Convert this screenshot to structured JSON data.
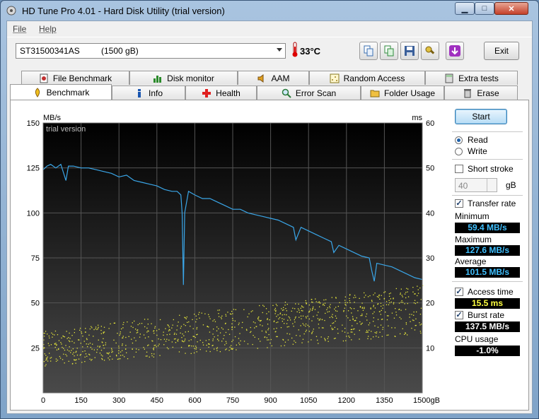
{
  "window": {
    "title": "HD Tune Pro 4.01 - Hard Disk Utility (trial version)"
  },
  "menu": {
    "items": [
      "File",
      "Help"
    ]
  },
  "toolbar": {
    "drive_name": "ST31500341AS",
    "drive_size": "(1500 gB)",
    "temperature": "33°C",
    "exit_label": "Exit"
  },
  "tabs": {
    "row1": [
      "File Benchmark",
      "Disk monitor",
      "AAM",
      "Random Access",
      "Extra tests"
    ],
    "row2": [
      "Benchmark",
      "Info",
      "Health",
      "Error Scan",
      "Folder Usage",
      "Erase"
    ],
    "active": "Benchmark"
  },
  "side": {
    "start_label": "Start",
    "read_label": "Read",
    "write_label": "Write",
    "mode_selected": "Read",
    "short_stroke_label": "Short stroke",
    "short_stroke_checked": false,
    "short_stroke_value": "40",
    "short_stroke_unit": "gB",
    "transfer_rate_label": "Transfer rate",
    "transfer_rate_checked": true,
    "minimum_label": "Minimum",
    "minimum_value": "59.4 MB/s",
    "maximum_label": "Maximum",
    "maximum_value": "127.6 MB/s",
    "average_label": "Average",
    "average_value": "101.5 MB/s",
    "access_time_label": "Access time",
    "access_time_checked": true,
    "access_time_value": "15.5 ms",
    "burst_rate_label": "Burst rate",
    "burst_rate_checked": true,
    "burst_rate_value": "137.5 MB/s",
    "cpu_usage_label": "CPU usage",
    "cpu_usage_value": "-1.0%"
  },
  "chart_data": {
    "type": "line",
    "watermark": "trial version",
    "y_left_unit": "MB/s",
    "y_right_unit": "ms",
    "x_unit": "gB",
    "xlim": [
      0,
      1500
    ],
    "ylim_left": [
      0,
      150
    ],
    "ylim_right": [
      0,
      60
    ],
    "x_ticks": [
      0,
      150,
      300,
      450,
      600,
      750,
      900,
      1050,
      1200,
      1350,
      1500
    ],
    "y_left_ticks": [
      25,
      50,
      75,
      100,
      125,
      150
    ],
    "y_right_ticks": [
      10,
      20,
      30,
      40,
      50,
      60
    ],
    "grid": true,
    "colors": {
      "background": "#0a0a0a",
      "transfer": "#3aa6e8",
      "access": "#e8e83a",
      "grid": "#555555"
    },
    "series": [
      {
        "x": [
          0,
          15,
          30,
          50,
          70,
          90,
          100,
          120,
          150,
          180,
          210,
          240,
          270,
          300,
          330,
          360,
          390,
          420,
          450,
          480,
          510,
          530,
          545,
          550,
          555,
          560,
          575,
          600,
          630,
          660,
          690,
          720,
          750,
          780,
          810,
          840,
          870,
          900,
          930,
          960,
          990,
          1000,
          1020,
          1050,
          1080,
          1110,
          1140,
          1150,
          1170,
          1200,
          1230,
          1260,
          1290,
          1300,
          1310,
          1320,
          1350,
          1380,
          1410,
          1440,
          1470,
          1500
        ],
        "values": [
          124,
          126,
          127,
          125,
          127,
          118,
          126,
          126,
          125,
          125,
          124,
          123,
          122,
          120,
          121,
          118,
          117,
          116,
          115,
          113,
          112,
          112,
          110,
          100,
          60,
          100,
          112,
          110,
          108,
          108,
          106,
          104,
          102,
          102,
          100,
          99,
          98,
          97,
          96,
          94,
          92,
          85,
          92,
          90,
          88,
          86,
          84,
          78,
          82,
          80,
          78,
          76,
          75,
          68,
          62,
          72,
          71,
          70,
          68,
          66,
          64,
          63
        ]
      }
    ],
    "access_time_band_ms": [
      5,
      24
    ]
  }
}
